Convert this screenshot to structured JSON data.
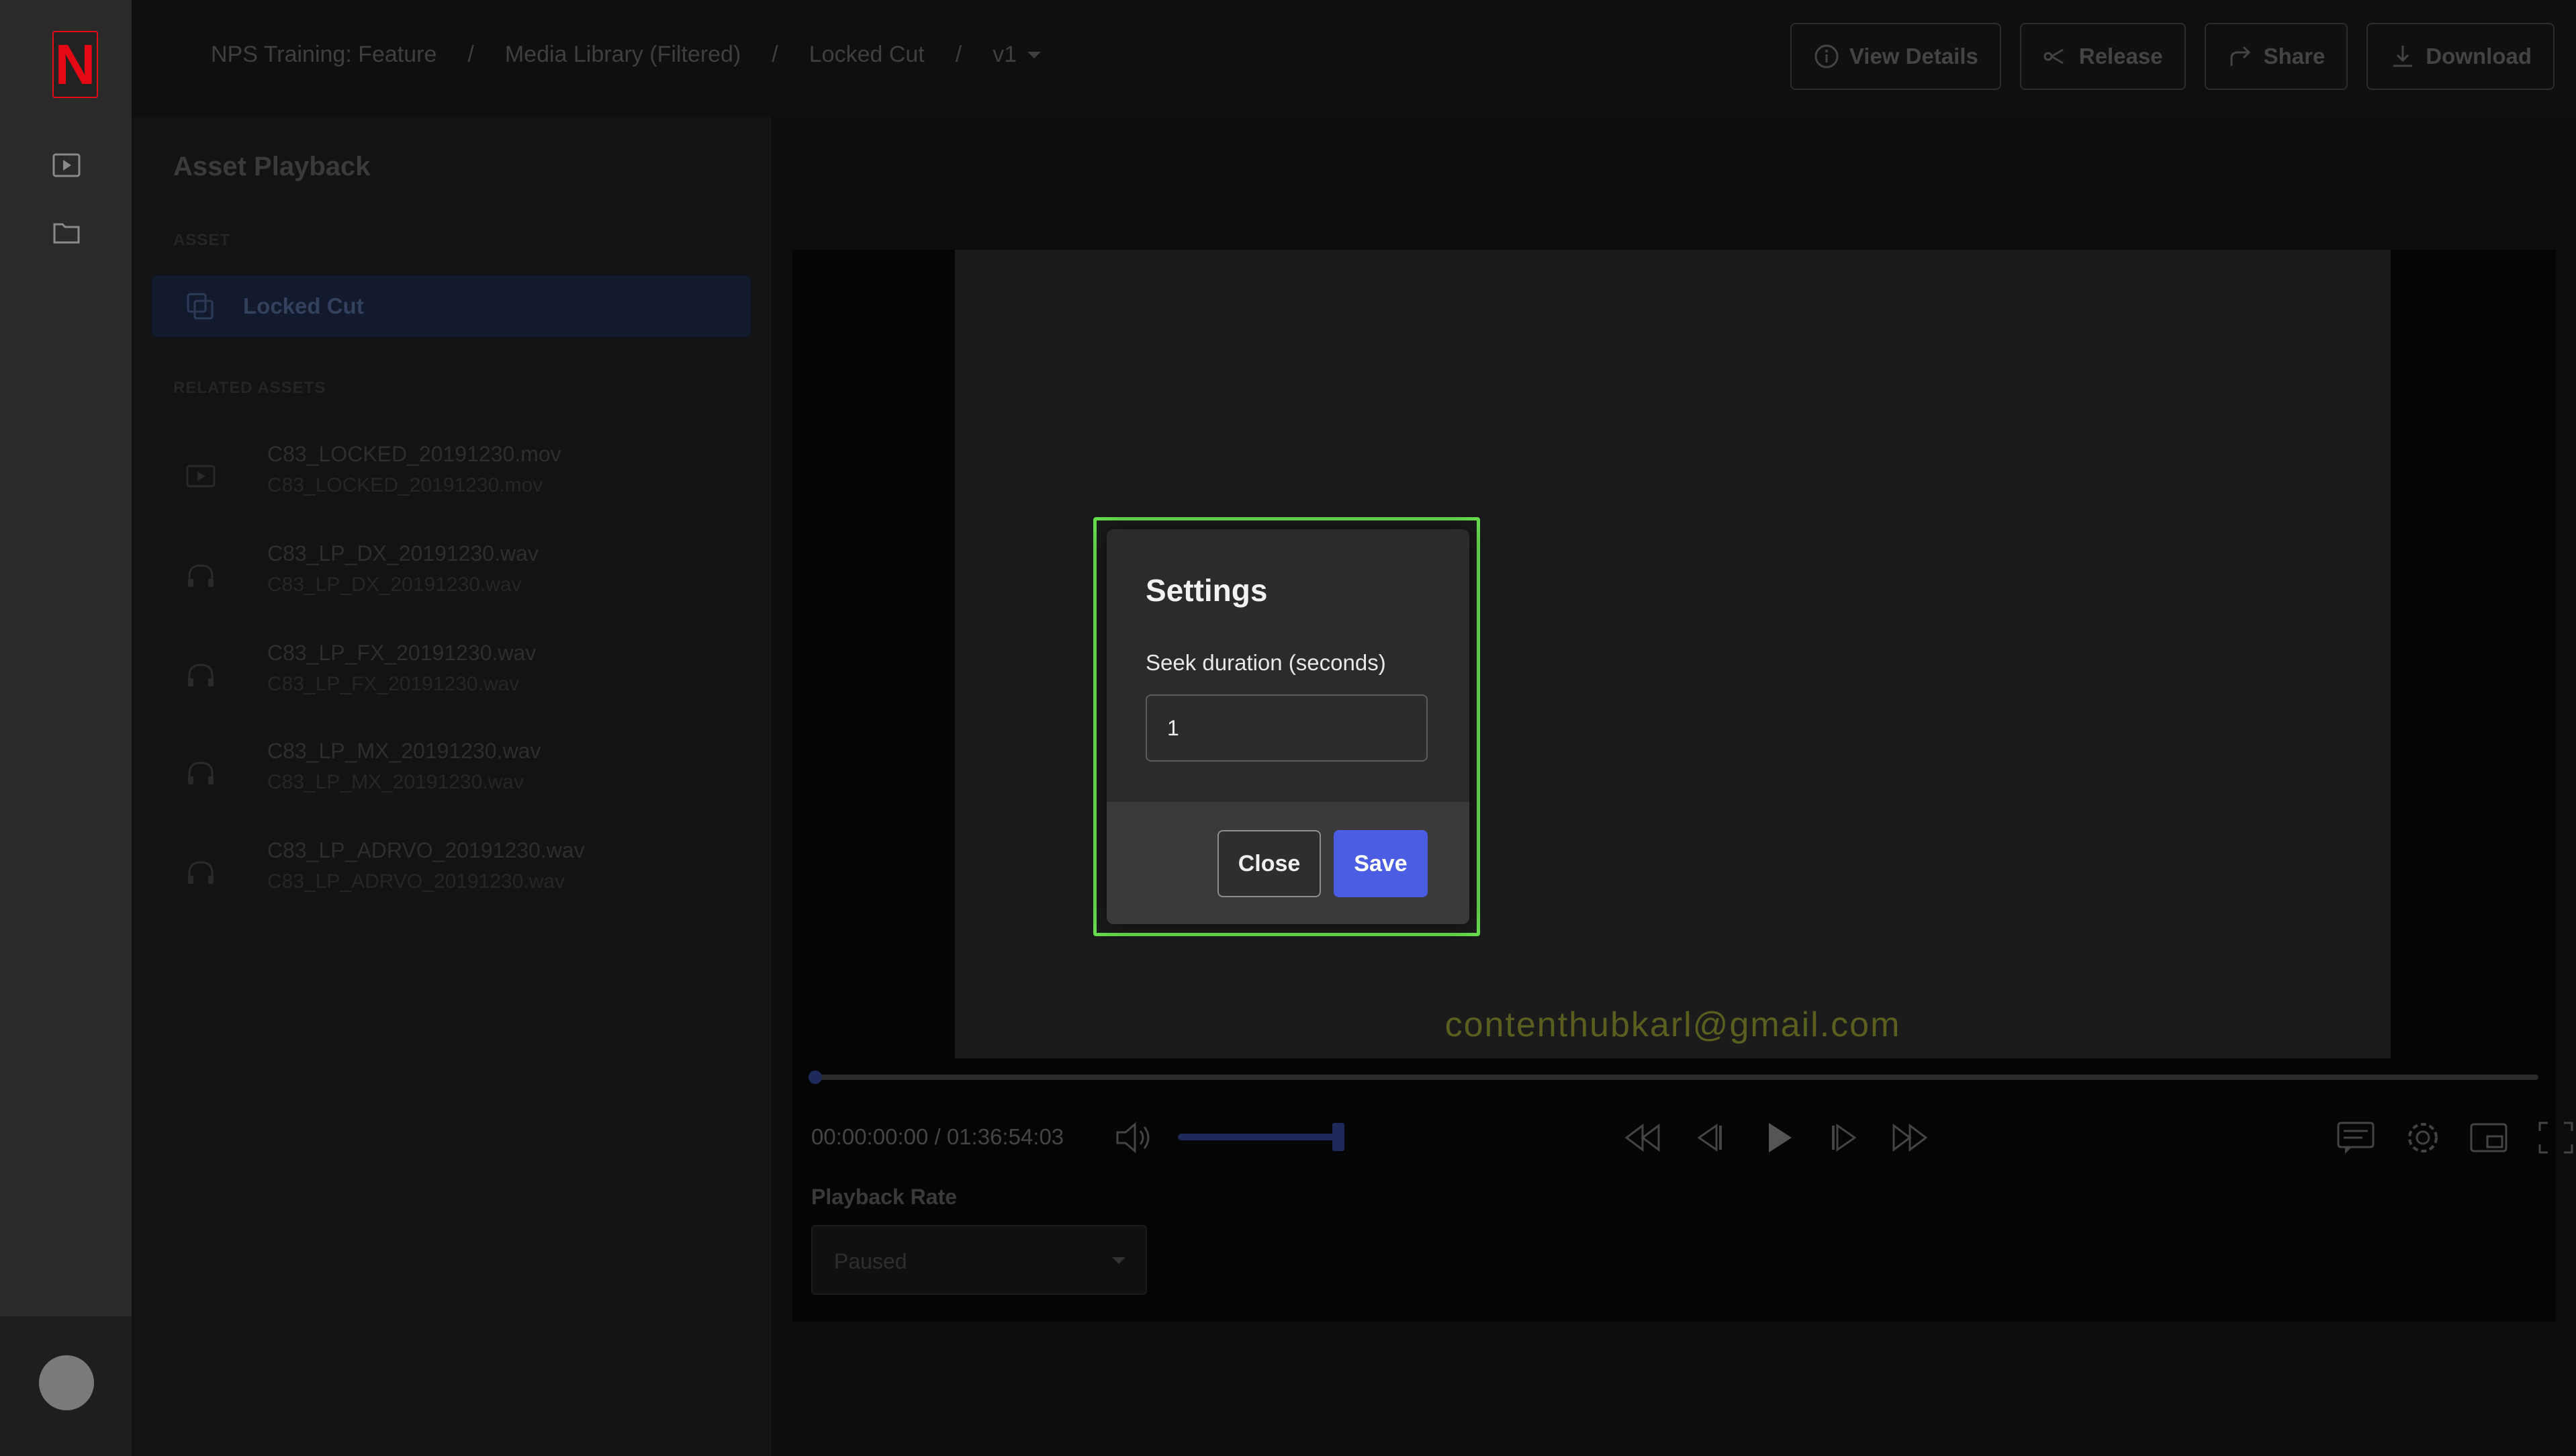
{
  "breadcrumb": {
    "project": "NPS Training: Feature",
    "library": "Media Library (Filtered)",
    "asset": "Locked Cut",
    "version": "v1",
    "separator": "/"
  },
  "actions": {
    "view_details": "View Details",
    "release": "Release",
    "share": "Share",
    "download": "Download"
  },
  "panel": {
    "title": "Asset Playback",
    "asset_section": "ASSET",
    "selected_asset": "Locked Cut",
    "related_section": "RELATED ASSETS",
    "related": [
      {
        "name": "C83_LOCKED_20191230.mov",
        "file": "C83_LOCKED_20191230.mov",
        "icon": "video-icon"
      },
      {
        "name": "C83_LP_DX_20191230.wav",
        "file": "C83_LP_DX_20191230.wav",
        "icon": "headphones-icon"
      },
      {
        "name": "C83_LP_FX_20191230.wav",
        "file": "C83_LP_FX_20191230.wav",
        "icon": "headphones-icon"
      },
      {
        "name": "C83_LP_MX_20191230.wav",
        "file": "C83_LP_MX_20191230.wav",
        "icon": "headphones-icon"
      },
      {
        "name": "C83_LP_ADRVO_20191230.wav",
        "file": "C83_LP_ADRVO_20191230.wav",
        "icon": "headphones-icon"
      }
    ]
  },
  "player": {
    "watermark": "contenthubkarl@gmail.com",
    "timecode": "00:00:00:00 / 01:36:54:03",
    "playback_rate_label": "Playback Rate",
    "playback_rate_value": "Paused"
  },
  "modal": {
    "title": "Settings",
    "field_label": "Seek duration (seconds)",
    "field_value": "1",
    "close_label": "Close",
    "save_label": "Save"
  },
  "colors": {
    "brand": "#e50914",
    "accent": "#4a5de3",
    "highlight": "#67df4e"
  }
}
